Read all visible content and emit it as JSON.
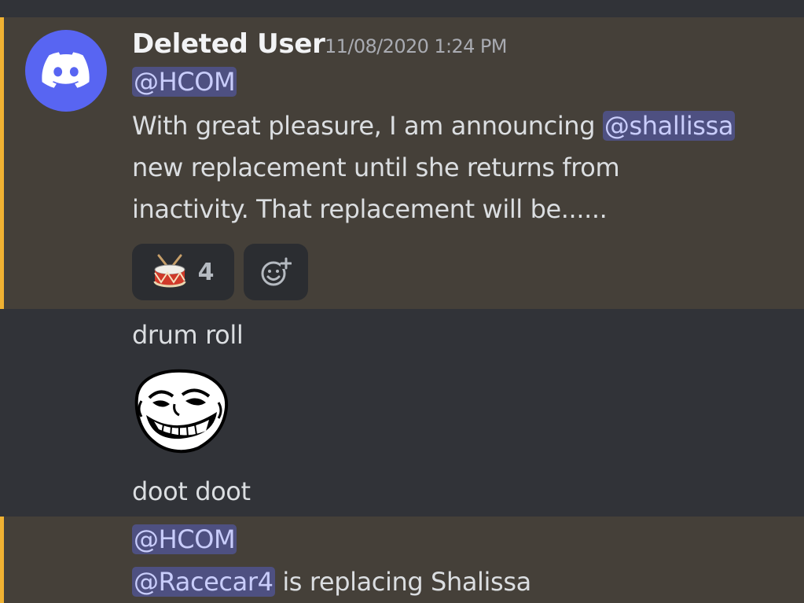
{
  "message1": {
    "author": "Deleted User",
    "timestamp": "11/08/2020 1:24 PM",
    "mention_role": "@HCOM",
    "text_line1_prefix": "With great pleasure, I am announcing ",
    "text_line1_mention": "@shallissa",
    "text_line2": "new replacement until she returns from",
    "text_line3": "inactivity. That replacement will be......",
    "reactions": [
      {
        "emoji": "drum-icon",
        "count": "4"
      }
    ],
    "add_reaction_icon": "add-reaction-icon"
  },
  "message2": {
    "text": "drum roll"
  },
  "message3": {
    "emoji": "trollface-icon"
  },
  "message4": {
    "text": "doot doot"
  },
  "message5": {
    "mention_role": "@HCOM",
    "mention_user": "@Racecar4",
    "text_suffix": " is replacing Shalissa"
  },
  "colors": {
    "background": "#313338",
    "highlight": "#454039",
    "highlight_bar": "#f0b232",
    "mention_bg": "#4e5081",
    "mention_text": "#c9cdfb",
    "avatar": "#5865f2"
  }
}
